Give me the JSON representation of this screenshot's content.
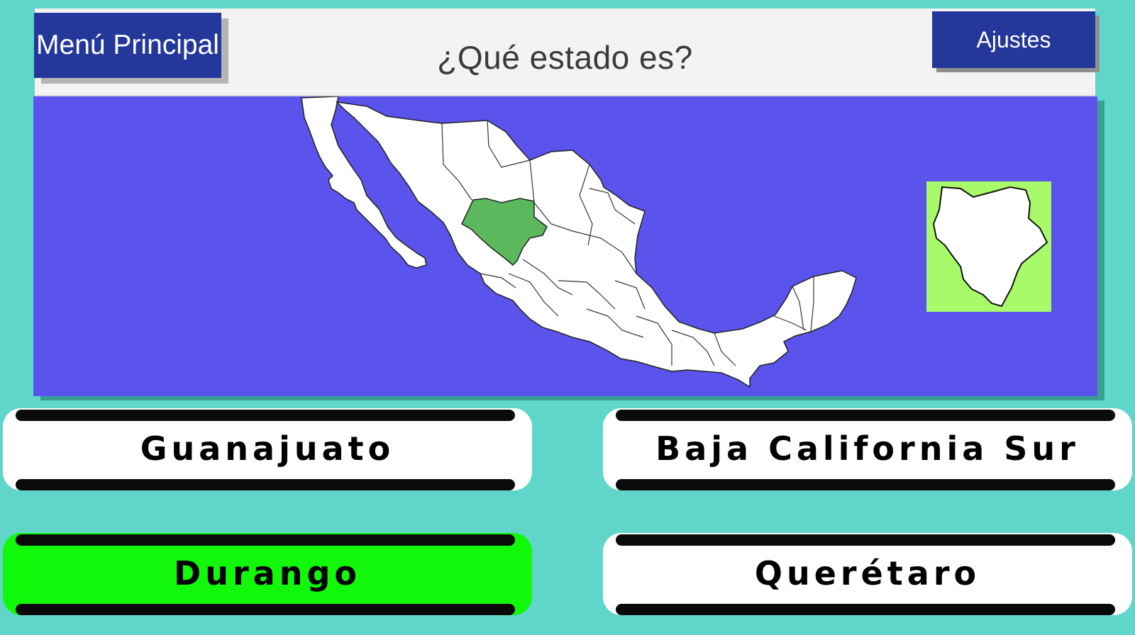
{
  "header": {
    "title": "¿Qué estado es?",
    "menu_label": "Menú Principal",
    "settings_label": "Ajustes"
  },
  "map": {
    "highlighted_state": "Durango",
    "colors": {
      "sea": "#5a53ec",
      "land": "#ffffff",
      "highlight": "#5bb85c",
      "thumb_bg": "#a9fa6b"
    }
  },
  "answers": [
    {
      "label": "Guanajuato",
      "state": "normal"
    },
    {
      "label": "Baja California Sur",
      "state": "normal"
    },
    {
      "label": "Durango",
      "state": "correct"
    },
    {
      "label": "Querétaro",
      "state": "normal"
    }
  ],
  "colors": {
    "background": "#5fd6c9",
    "button": "#23389a",
    "correct": "#12f80a"
  }
}
